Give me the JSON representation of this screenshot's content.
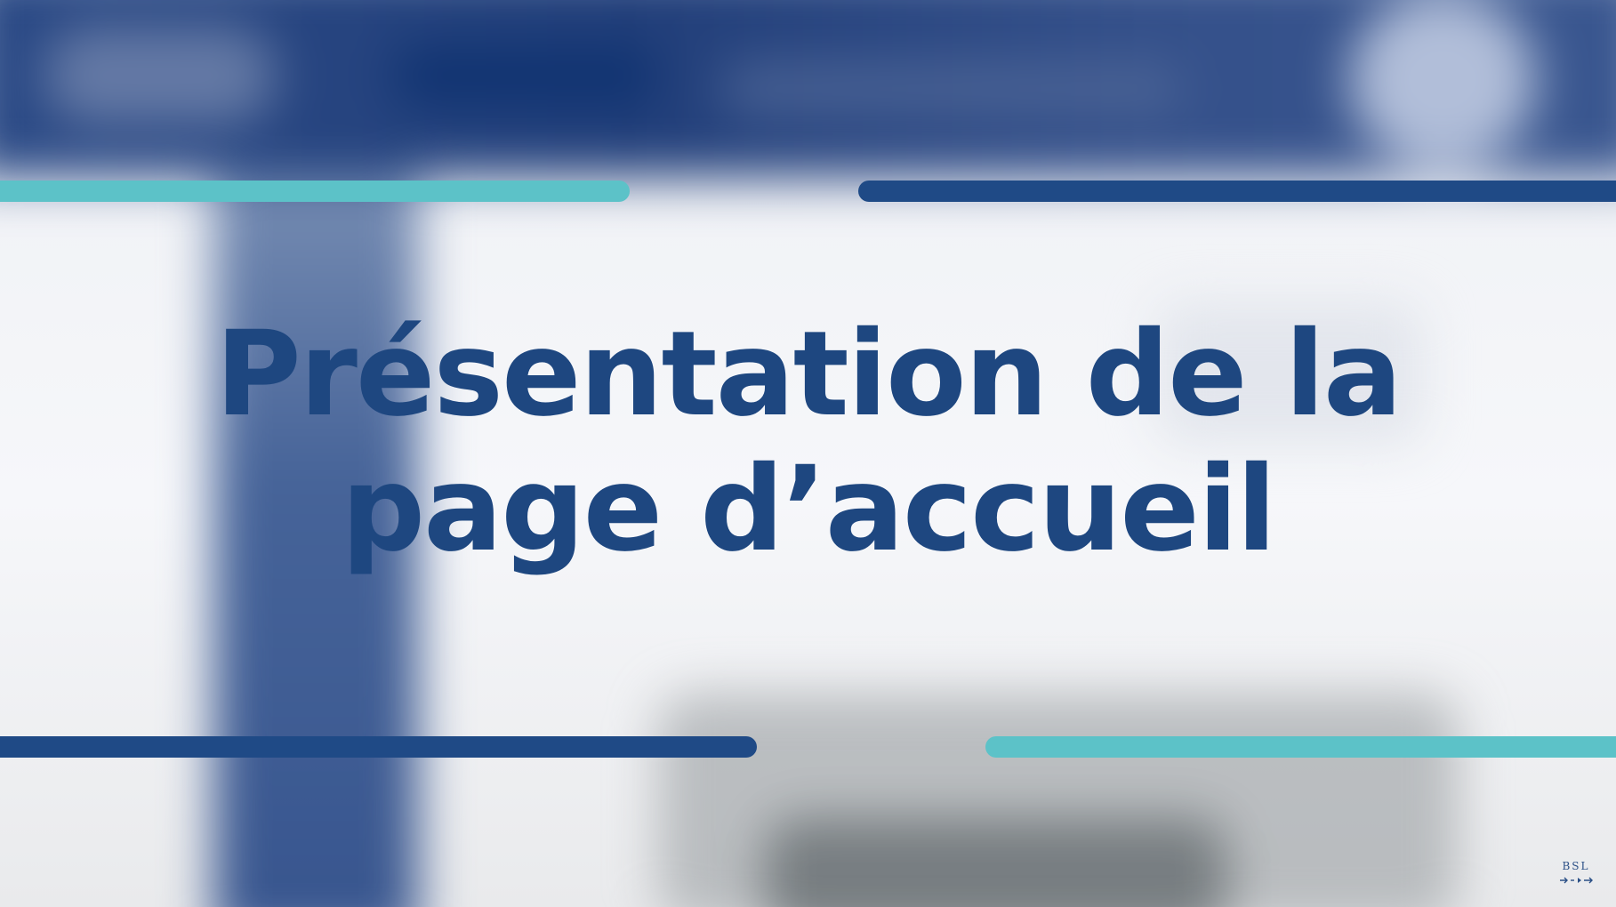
{
  "slide": {
    "title_line1": "Présentation de la",
    "title_line2": "page d’accueil"
  },
  "logo": {
    "text": "BSL",
    "icon": "bsl-logo-icon"
  },
  "colors": {
    "title": "#1e4780",
    "bar_dark": "#1f4a86",
    "bar_teal": "#5cc2c8",
    "logo": "#2a4f86"
  }
}
